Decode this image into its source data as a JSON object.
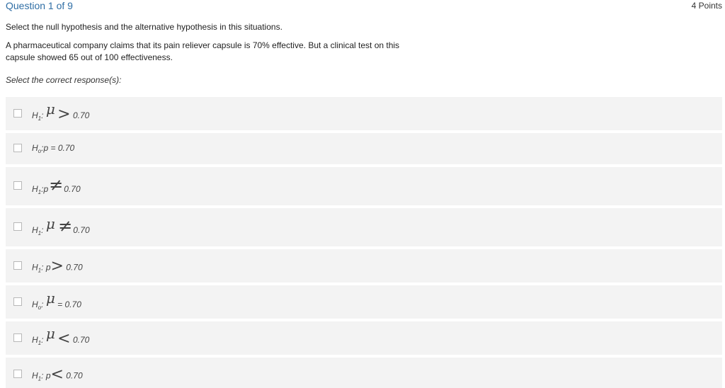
{
  "question": {
    "title": "Question 1 of 9",
    "points": "4 Points",
    "instruction": "Select the null hypothesis and the alternative hypothesis in this situations.",
    "scenario": "A pharmaceutical company claims that its pain reliever capsule is 70% effective. But a clinical test on this capsule showed 65 out of 100 effectiveness.",
    "select_label": "Select the correct response(s):"
  },
  "options": [
    {
      "h": "H",
      "sub": "1",
      "sep": ":",
      "var": "μ",
      "op": ">",
      "value": "0.70"
    },
    {
      "h": "H",
      "sub": "o",
      "sep": ":",
      "var": "p",
      "op": "=",
      "value": "0.70"
    },
    {
      "h": "H",
      "sub": "1",
      "sep": ":",
      "var": "p",
      "op": "≠",
      "value": "0.70"
    },
    {
      "h": "H",
      "sub": "1",
      "sep": ":",
      "var": "μ",
      "op": "≠",
      "value": "0.70"
    },
    {
      "h": "H",
      "sub": "1",
      "sep": ":",
      "var": "p",
      "op": ">",
      "value": "0.70"
    },
    {
      "h": "H",
      "sub": "o",
      "sep": ":",
      "var": "μ",
      "op": "=",
      "value": "0.70"
    },
    {
      "h": "H",
      "sub": "1",
      "sep": ":",
      "var": "μ",
      "op": "<",
      "value": "0.70"
    },
    {
      "h": "H",
      "sub": "1",
      "sep": ":",
      "var": "p",
      "op": "<",
      "value": "0.70"
    }
  ],
  "colors": {
    "title": "#2f6ea5",
    "option_bg": "#f3f3f3",
    "checkbox_border": "#b8b8b8"
  }
}
